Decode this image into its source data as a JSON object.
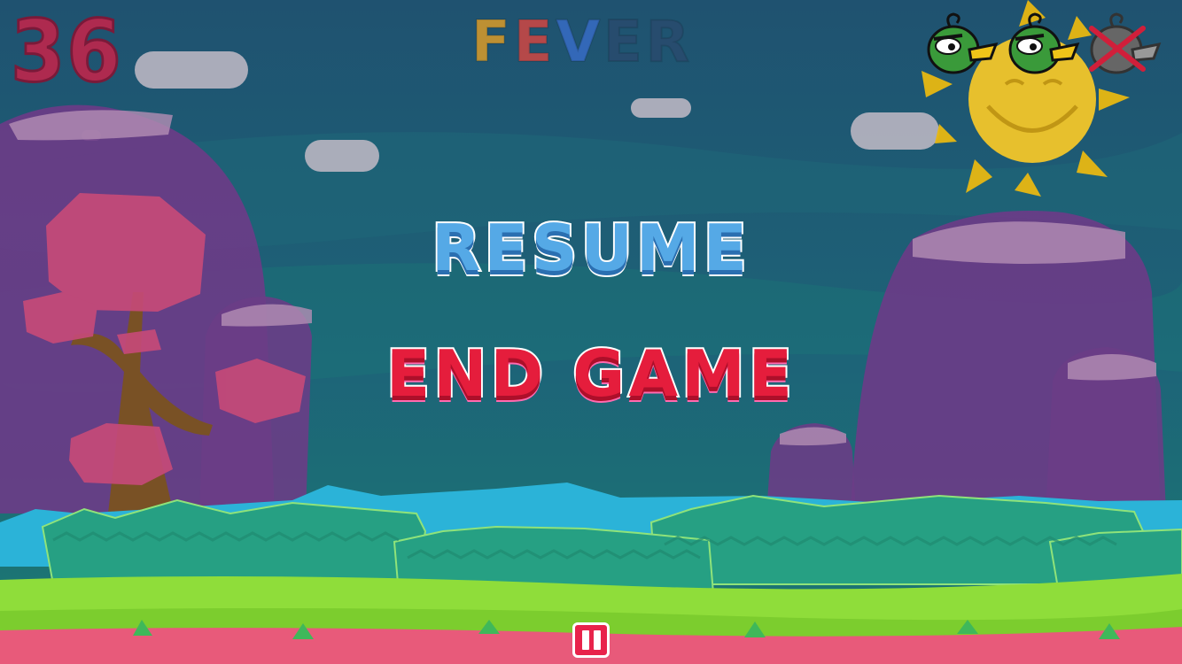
{
  "hud": {
    "score": "36",
    "fever_letters": [
      {
        "char": "F",
        "color": "#f2a51f"
      },
      {
        "char": "E",
        "color": "#e8453c"
      },
      {
        "char": "V",
        "color": "#3a6fd0"
      },
      {
        "char": "E",
        "color": "#2a4a6e"
      },
      {
        "char": "R",
        "color": "#2a4a6e"
      }
    ],
    "lives": [
      {
        "state": "active",
        "icon": "green-bird-icon"
      },
      {
        "state": "active",
        "icon": "green-bird-icon"
      },
      {
        "state": "lost",
        "icon": "crossed-bird-icon"
      }
    ]
  },
  "pause_menu": {
    "resume_label": "RESUME",
    "end_game_label": "END GAME"
  },
  "controls": {
    "pause_icon": "pause-icon"
  },
  "colors": {
    "sky": "#1e5f7a",
    "resume": "#55a9e6",
    "end_game": "#e51d3c",
    "grass": "#8fdd3a",
    "ground": "#e85a7a",
    "sun": "#f0c419"
  }
}
